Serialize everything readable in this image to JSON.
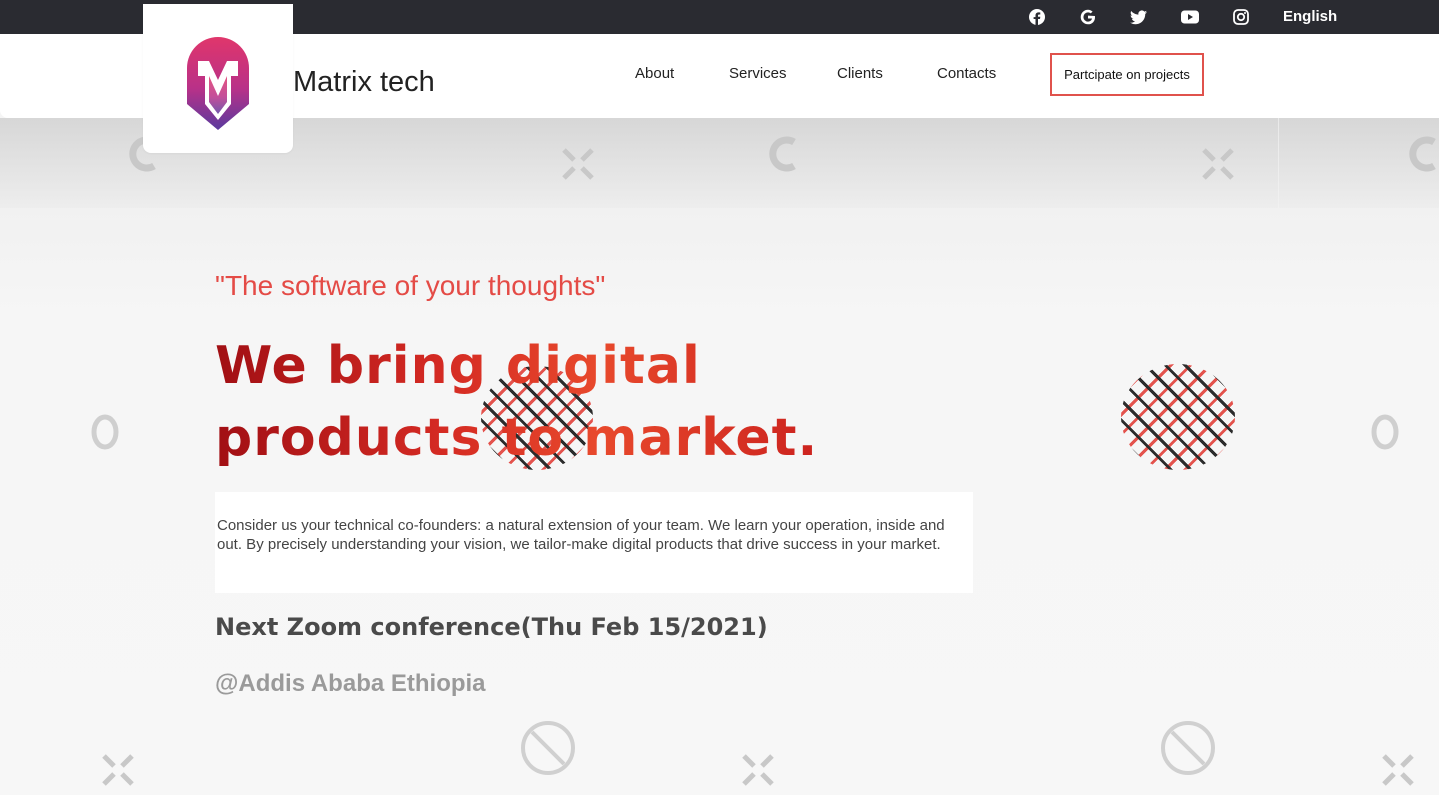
{
  "topbar": {
    "social": [
      {
        "name": "facebook-icon",
        "glyph": "f"
      },
      {
        "name": "google-icon",
        "glyph": "G"
      },
      {
        "name": "twitter-icon",
        "glyph": "🐦"
      },
      {
        "name": "youtube-icon",
        "glyph": "▶"
      },
      {
        "name": "instagram-icon",
        "glyph": "◎"
      }
    ],
    "language": "English"
  },
  "header": {
    "brand": "Matrix tech",
    "nav": [
      "About",
      "Services",
      "Clients",
      "Contacts"
    ],
    "cta": "Partcipate on projects"
  },
  "hero": {
    "quote": "\"The software of your thoughts\"",
    "headline_line1": "We bring digital",
    "headline_line2": "products to market.",
    "description": "Consider us your technical co-founders: a natural extension of your team. We learn your operation, inside and out. By precisely understanding your vision, we tailor-make digital products that drive success in your market.",
    "event": "Next Zoom conference(Thu Feb 15/2021)",
    "location": "@Addis Ababa Ethiopia"
  },
  "colors": {
    "accent": "#e44b46",
    "topbar": "#2a2b31",
    "logo_pink": "#d2326a",
    "logo_purple": "#6b3aa0"
  }
}
